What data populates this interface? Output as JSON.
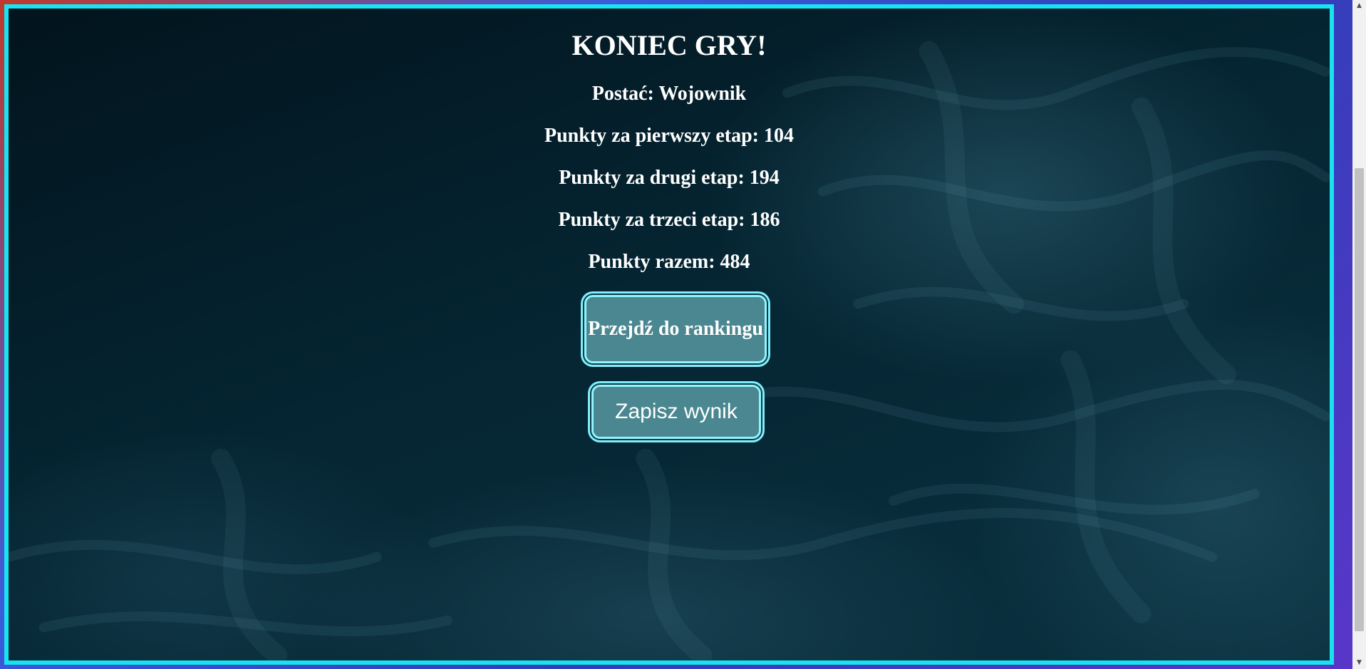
{
  "game_over": {
    "title": "KONIEC GRY!",
    "character": "Postać: Wojownik",
    "stage1": "Punkty za pierwszy etap: 104",
    "stage2": "Punkty za drugi etap: 194",
    "stage3": "Punkty za trzeci etap: 186",
    "total": "Punkty razem: 484"
  },
  "buttons": {
    "ranking_label": "Przejdź do rankingu",
    "save_label": "Zapisz wynik"
  },
  "colors": {
    "frame_border": "#19e3f0",
    "button_fill": "#4a8790",
    "button_border": "#8ff4ff",
    "text": "#ffffff"
  },
  "icons": {
    "scroll_up": "scroll-up-arrow-icon",
    "scroll_down": "scroll-down-arrow-icon"
  }
}
